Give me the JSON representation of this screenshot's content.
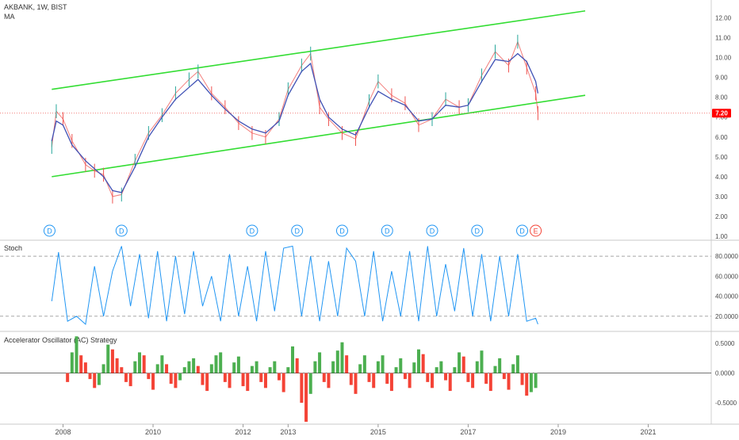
{
  "header": {
    "symbol": "AKBANK, 1W, BIST",
    "indicator": "MA"
  },
  "colors": {
    "channel": "#33dd33",
    "price_up": "#26a69a",
    "price_down": "#ef5350",
    "ma": "#3f51b5",
    "stoch": "#2196f3",
    "ac_up": "#4caf50",
    "ac_down": "#f44336",
    "price_label_bg": "#ff0000",
    "dividend": "#2196f3",
    "earnings": "#f44336"
  },
  "chart_data": [
    {
      "type": "line",
      "title": "AKBANK, 1W, BIST",
      "subtitle": "MA",
      "ylim": [
        1.0,
        12.5
      ],
      "yticks": [
        "1.00",
        "2.00",
        "3.00",
        "4.00",
        "5.00",
        "6.00",
        "7.00",
        "8.00",
        "9.00",
        "10.00",
        "11.00",
        "12.00"
      ],
      "x": [
        2007.75,
        2007.85,
        2008.0,
        2008.2,
        2008.5,
        2008.7,
        2008.9,
        2009.1,
        2009.3,
        2009.6,
        2009.9,
        2010.2,
        2010.5,
        2010.8,
        2011.0,
        2011.3,
        2011.6,
        2011.9,
        2012.2,
        2012.5,
        2012.8,
        2013.0,
        2013.3,
        2013.5,
        2013.7,
        2013.9,
        2014.2,
        2014.5,
        2014.8,
        2015.0,
        2015.3,
        2015.6,
        2015.9,
        2016.2,
        2016.5,
        2016.8,
        2017.0,
        2017.3,
        2017.6,
        2017.9,
        2018.1,
        2018.3,
        2018.5,
        2018.55
      ],
      "series": [
        {
          "values": [
            5.5,
            7.3,
            6.9,
            5.8,
            4.6,
            4.3,
            4.1,
            3.0,
            3.1,
            4.8,
            6.2,
            7.1,
            8.2,
            8.9,
            9.3,
            8.2,
            7.5,
            6.7,
            6.2,
            6.0,
            6.9,
            8.4,
            9.6,
            10.2,
            7.5,
            6.9,
            6.2,
            5.9,
            7.8,
            8.8,
            8.1,
            7.7,
            6.6,
            6.9,
            7.9,
            7.5,
            7.6,
            9.1,
            10.3,
            9.6,
            10.8,
            9.5,
            8.2,
            7.2
          ]
        },
        {
          "values": [
            5.8,
            6.8,
            6.6,
            5.6,
            4.8,
            4.4,
            4.0,
            3.3,
            3.2,
            4.5,
            6.0,
            7.0,
            7.9,
            8.5,
            8.9,
            8.1,
            7.4,
            6.8,
            6.4,
            6.2,
            6.8,
            8.1,
            9.3,
            9.7,
            7.9,
            7.0,
            6.4,
            6.1,
            7.5,
            8.3,
            7.9,
            7.6,
            6.8,
            6.9,
            7.6,
            7.5,
            7.6,
            8.8,
            9.9,
            9.8,
            10.2,
            9.8,
            8.8,
            8.2
          ]
        }
      ],
      "last_price_label": "7.20",
      "channel_upper": {
        "x": [
          2007.75,
          2019.6
        ],
        "y": [
          8.4,
          12.35
        ]
      },
      "channel_lower": {
        "x": [
          2007.75,
          2019.6
        ],
        "y": [
          4.0,
          8.1
        ]
      },
      "dividends": [
        2007.7,
        2009.3,
        2012.2,
        2013.2,
        2014.2,
        2015.2,
        2016.2,
        2017.2,
        2018.2
      ],
      "earnings": [
        2018.5
      ],
      "dividend_label": "D",
      "earnings_label": "E"
    },
    {
      "type": "line",
      "title": "Stoch",
      "ylim": [
        8,
        92
      ],
      "yticks": [
        "20.0000",
        "40.0000",
        "60.0000",
        "80.0000"
      ],
      "levels": [
        20,
        80
      ],
      "x": [
        2007.75,
        2007.9,
        2008.1,
        2008.3,
        2008.5,
        2008.7,
        2008.9,
        2009.1,
        2009.3,
        2009.5,
        2009.7,
        2009.9,
        2010.1,
        2010.3,
        2010.5,
        2010.7,
        2010.9,
        2011.1,
        2011.3,
        2011.5,
        2011.7,
        2011.9,
        2012.1,
        2012.3,
        2012.5,
        2012.7,
        2012.9,
        2013.1,
        2013.3,
        2013.5,
        2013.7,
        2013.9,
        2014.1,
        2014.3,
        2014.5,
        2014.7,
        2014.9,
        2015.1,
        2015.3,
        2015.5,
        2015.7,
        2015.9,
        2016.1,
        2016.3,
        2016.5,
        2016.7,
        2016.9,
        2017.1,
        2017.3,
        2017.5,
        2017.7,
        2017.9,
        2018.1,
        2018.3,
        2018.5,
        2018.55
      ],
      "series": [
        {
          "values": [
            35,
            84,
            15,
            20,
            12,
            70,
            20,
            65,
            90,
            30,
            82,
            18,
            85,
            15,
            80,
            22,
            85,
            30,
            60,
            15,
            82,
            20,
            70,
            15,
            85,
            25,
            88,
            90,
            20,
            80,
            15,
            75,
            20,
            88,
            75,
            20,
            85,
            15,
            65,
            20,
            85,
            15,
            90,
            20,
            72,
            25,
            88,
            20,
            82,
            15,
            80,
            20,
            82,
            15,
            18,
            12
          ]
        }
      ]
    },
    {
      "type": "bar",
      "title": "Accelerator Oscillator (AC) Strategy",
      "ylim": [
        -0.82,
        0.65
      ],
      "yticks": [
        "-0.5000",
        "0.0000",
        "0.5000"
      ],
      "x": [
        2008.1,
        2008.2,
        2008.3,
        2008.4,
        2008.5,
        2008.6,
        2008.7,
        2008.8,
        2008.9,
        2009.0,
        2009.1,
        2009.2,
        2009.3,
        2009.4,
        2009.5,
        2009.6,
        2009.7,
        2009.8,
        2009.9,
        2010.0,
        2010.1,
        2010.2,
        2010.3,
        2010.4,
        2010.5,
        2010.6,
        2010.7,
        2010.8,
        2010.9,
        2011.0,
        2011.1,
        2011.2,
        2011.3,
        2011.4,
        2011.5,
        2011.6,
        2011.7,
        2011.8,
        2011.9,
        2012.0,
        2012.1,
        2012.2,
        2012.3,
        2012.4,
        2012.5,
        2012.6,
        2012.7,
        2012.8,
        2012.9,
        2013.0,
        2013.1,
        2013.2,
        2013.3,
        2013.4,
        2013.5,
        2013.6,
        2013.7,
        2013.8,
        2013.9,
        2014.0,
        2014.1,
        2014.2,
        2014.3,
        2014.4,
        2014.5,
        2014.6,
        2014.7,
        2014.8,
        2014.9,
        2015.0,
        2015.1,
        2015.2,
        2015.3,
        2015.4,
        2015.5,
        2015.6,
        2015.7,
        2015.8,
        2015.9,
        2016.0,
        2016.1,
        2016.2,
        2016.3,
        2016.4,
        2016.5,
        2016.6,
        2016.7,
        2016.8,
        2016.9,
        2017.0,
        2017.1,
        2017.2,
        2017.3,
        2017.4,
        2017.5,
        2017.6,
        2017.7,
        2017.8,
        2017.9,
        2018.0,
        2018.1,
        2018.2,
        2018.3,
        2018.4,
        2018.5
      ],
      "series": [
        {
          "values": [
            -0.15,
            0.35,
            0.62,
            0.3,
            0.18,
            -0.1,
            -0.25,
            -0.2,
            0.15,
            0.48,
            0.4,
            0.25,
            0.1,
            -0.15,
            -0.22,
            0.2,
            0.35,
            0.3,
            -0.1,
            -0.28,
            0.15,
            0.3,
            0.15,
            -0.18,
            -0.25,
            -0.12,
            0.1,
            0.2,
            0.25,
            0.12,
            -0.2,
            -0.3,
            0.15,
            0.3,
            0.35,
            -0.15,
            -0.25,
            0.18,
            0.28,
            -0.22,
            -0.3,
            0.12,
            0.2,
            -0.15,
            -0.25,
            0.1,
            0.2,
            -0.12,
            -0.32,
            0.1,
            0.45,
            0.25,
            -0.5,
            -0.82,
            -0.35,
            0.2,
            0.35,
            -0.15,
            -0.25,
            0.2,
            0.38,
            0.52,
            0.3,
            -0.2,
            -0.35,
            0.15,
            0.3,
            -0.15,
            -0.25,
            0.2,
            0.3,
            -0.18,
            -0.3,
            0.1,
            0.25,
            -0.1,
            -0.25,
            0.18,
            0.4,
            0.32,
            -0.15,
            -0.25,
            0.1,
            0.2,
            -0.12,
            -0.3,
            0.1,
            0.35,
            0.28,
            -0.15,
            -0.25,
            0.2,
            0.38,
            -0.18,
            -0.3,
            0.12,
            0.25,
            -0.1,
            -0.28,
            0.15,
            0.3,
            -0.2,
            -0.38,
            -0.32,
            -0.25
          ]
        }
      ]
    }
  ],
  "xaxis": {
    "range": [
      2006.6,
      2022.4
    ],
    "ticks": [
      {
        "value": 2008,
        "label": "2008"
      },
      {
        "value": 2010,
        "label": "2010"
      },
      {
        "value": 2012,
        "label": "2012"
      },
      {
        "value": 2013,
        "label": "2013"
      },
      {
        "value": 2015,
        "label": "2015"
      },
      {
        "value": 2017,
        "label": "2017"
      },
      {
        "value": 2019,
        "label": "2019"
      },
      {
        "value": 2021,
        "label": "2021"
      }
    ]
  }
}
